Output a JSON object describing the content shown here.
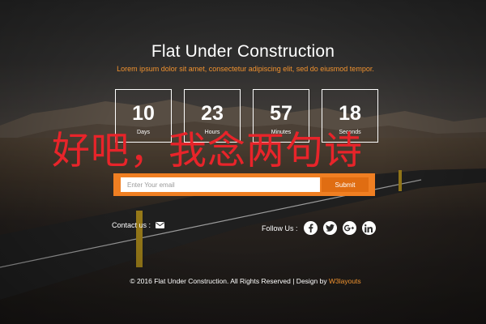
{
  "header": {
    "title": "Flat Under Construction",
    "subtitle": "Lorem ipsum dolor sit amet, consectetur adipiscing elit, sed do eiusmod tempor."
  },
  "countdown": [
    {
      "value": "10",
      "label": "Days"
    },
    {
      "value": "23",
      "label": "Hours"
    },
    {
      "value": "57",
      "label": "Minutes"
    },
    {
      "value": "18",
      "label": "Seconds"
    }
  ],
  "watermark_text": "好吧，我念两句诗",
  "subscribe": {
    "email_placeholder": "Enter Your email",
    "submit_label": "Submit"
  },
  "contact": {
    "label": "Contact us :",
    "icon": "envelope-icon"
  },
  "follow": {
    "label": "Follow Us :",
    "icons": [
      "facebook-icon",
      "twitter-icon",
      "google-plus-icon",
      "linkedin-icon"
    ]
  },
  "footer": {
    "copyright": "© 2016 Flat Under Construction. All Rights Reserved | Design by",
    "link_text": "W3layouts"
  },
  "colors": {
    "accent": "#f0922f",
    "form_bar": "#f07f22",
    "submit_button": "#e06d12",
    "watermark": "#e8242a",
    "text": "#ffffff"
  }
}
